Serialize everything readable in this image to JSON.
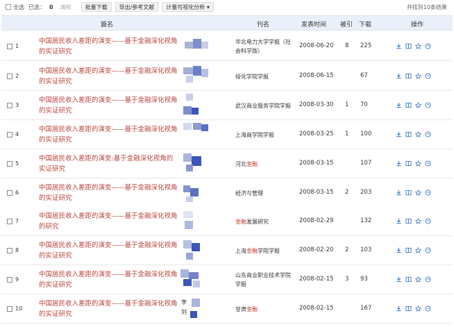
{
  "toolbar": {
    "select_all_label": "全选",
    "selected_label": "已选：",
    "selected_count": "0",
    "clear_label": "清除",
    "batch_download_label": "批量下载",
    "export_label": "导出/参考文献",
    "analysis_label": "计量可视化分析",
    "analysis_arrow": "▾",
    "found_text": "共找到10条结果"
  },
  "table": {
    "headers": {
      "title": "篇名",
      "author": "",
      "source": "刊名",
      "date": "发表时间",
      "cited": "被引",
      "downloads": "下载",
      "actions": "操作"
    },
    "rows": [
      {
        "num": "1",
        "title": "中国居民收入差距的演变——基于金融深化视角的实证研究",
        "source_plain": "华北电力大学学报（社会科学版）",
        "source_hl": "",
        "source_after": "",
        "date": "2008-06-20",
        "cited": "8",
        "downloads": "225"
      },
      {
        "num": "2",
        "title": "中国居民收入差距的演变——基于金融深化视角的实证研究",
        "source_plain": "绥化学院学报",
        "source_hl": "",
        "source_after": "",
        "date": "2008-06-15",
        "cited": "",
        "downloads": "67"
      },
      {
        "num": "3",
        "title": "中国居民收入差距的演变——基于金融深化视角的实证研究",
        "source_plain": "武汉商业服务学院学报",
        "source_hl": "",
        "source_after": "",
        "date": "2008-03-30",
        "cited": "1",
        "downloads": "70"
      },
      {
        "num": "4",
        "title": "中国居民收入差距的演变——基于金融深化视角的实证研究",
        "source_plain": "上海商学院学报",
        "source_hl": "",
        "source_after": "",
        "date": "2008-03-25",
        "cited": "1",
        "downloads": "100"
      },
      {
        "num": "5",
        "title": "中国居民收入差距的演变:基于金融深化视角的实证研究",
        "source_plain": "河北",
        "source_hl": "金融",
        "source_after": "",
        "date": "2008-03-15",
        "cited": "",
        "downloads": "107"
      },
      {
        "num": "6",
        "title": "中国居民收入差距的演变——基于金融深化视角的实证研究",
        "source_plain": "经济与管理",
        "source_hl": "",
        "source_after": "",
        "date": "2008-03-15",
        "cited": "2",
        "downloads": "203"
      },
      {
        "num": "7",
        "title": "中国居民收入差距的演变——基于金融深化视角的研究",
        "source_plain": "",
        "source_hl": "金融",
        "source_after": "发展研究",
        "date": "2008-02-29",
        "cited": "",
        "downloads": "132"
      },
      {
        "num": "8",
        "title": "中国居民收入差距的演变——基于金融深化视角的实证研究",
        "source_plain": "上海",
        "source_hl": "金融",
        "source_after": "学院学报",
        "date": "2008-02-20",
        "cited": "2",
        "downloads": "103"
      },
      {
        "num": "9",
        "title": "中国居民收入差距的演变——基于金融深化视角的实证研究",
        "source_plain": "山东商业职业技术学院学报",
        "source_hl": "",
        "source_after": "",
        "date": "2008-02-15",
        "cited": "3",
        "downloads": "93"
      },
      {
        "num": "10",
        "title": "中国居民收入差距的演变——基于金融深化视角的实证研究",
        "source_plain": "甘肃",
        "source_hl": "金融",
        "source_after": "",
        "date": "2008-02-15",
        "cited": "",
        "downloads": "167"
      }
    ]
  },
  "row10_author_fragments": [
    "李",
    "刘"
  ],
  "icons": [
    "download-icon",
    "read-icon",
    "favorite-icon",
    "cite-icon"
  ],
  "colors": {
    "title_red": "#b8433c",
    "highlight_red": "#c0392b",
    "header_bg": "#eaf0f9",
    "icon_blue": "#3d78c4",
    "mosaic_dark": "#3d55b8"
  }
}
